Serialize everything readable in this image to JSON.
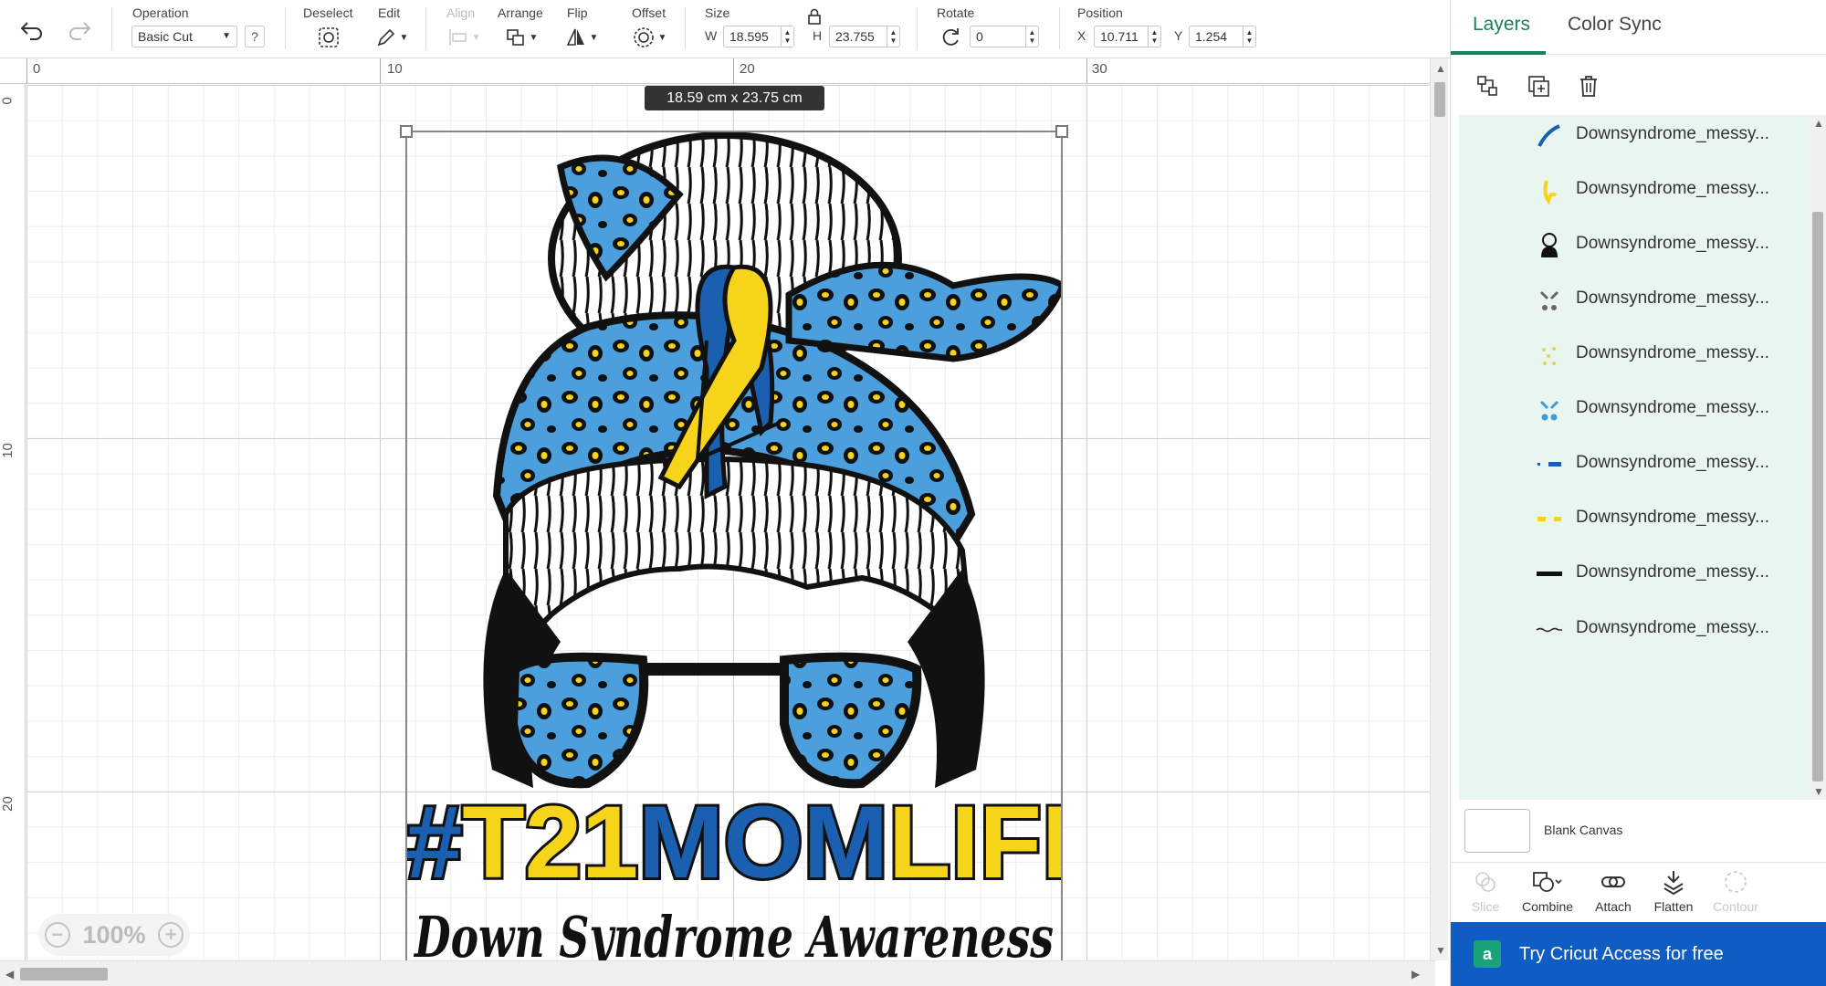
{
  "toolbar": {
    "operation_label": "Operation",
    "operation_value": "Basic Cut",
    "help_label": "?",
    "deselect_label": "Deselect",
    "edit_label": "Edit",
    "align_label": "Align",
    "arrange_label": "Arrange",
    "flip_label": "Flip",
    "offset_label": "Offset",
    "size_label": "Size",
    "width_prefix": "W",
    "width_value": "18.595",
    "height_prefix": "H",
    "height_value": "23.755",
    "rotate_label": "Rotate",
    "rotate_value": "0",
    "position_label": "Position",
    "x_prefix": "X",
    "x_value": "10.711",
    "y_prefix": "Y",
    "y_value": "1.254"
  },
  "canvas": {
    "ruler_top": [
      "0",
      "10",
      "20",
      "30"
    ],
    "ruler_left": [
      "0",
      "10",
      "20"
    ],
    "size_tooltip": "18.59  cm x 23.75  cm",
    "zoom_level": "100%"
  },
  "design": {
    "headline_hash": "#",
    "headline_t21": "T21",
    "headline_mom": "MOM",
    "headline_life": "LIFE",
    "subtitle": "Down Syndrome Awareness",
    "colors": {
      "blue": "#1b5fb0",
      "light_blue": "#3f9ad8",
      "yellow": "#f6d41a",
      "black": "#111111"
    }
  },
  "panel": {
    "tabs": [
      {
        "label": "Layers"
      },
      {
        "label": "Color Sync"
      }
    ],
    "layers": [
      {
        "name": "Downsyndrome_messy...",
        "thumb": "blue-stroke-icon"
      },
      {
        "name": "Downsyndrome_messy...",
        "thumb": "yellow-stroke-icon"
      },
      {
        "name": "Downsyndrome_messy...",
        "thumb": "messy-bun-icon"
      },
      {
        "name": "Downsyndrome_messy...",
        "thumb": "gray-shapes-icon"
      },
      {
        "name": "Downsyndrome_messy...",
        "thumb": "yellow-spots-icon"
      },
      {
        "name": "Downsyndrome_messy...",
        "thumb": "blue-shapes-icon"
      },
      {
        "name": "Downsyndrome_messy...",
        "thumb": "blue-text-icon"
      },
      {
        "name": "Downsyndrome_messy...",
        "thumb": "yellow-text-icon"
      },
      {
        "name": "Downsyndrome_messy...",
        "thumb": "black-text-icon"
      },
      {
        "name": "Downsyndrome_messy...",
        "thumb": "script-text-icon"
      }
    ],
    "blank_canvas_label": "Blank Canvas",
    "bottom_tools": [
      {
        "label": "Slice"
      },
      {
        "label": "Combine"
      },
      {
        "label": "Attach"
      },
      {
        "label": "Flatten"
      },
      {
        "label": "Contour"
      }
    ],
    "cta_label": "Try Cricut Access for free"
  }
}
